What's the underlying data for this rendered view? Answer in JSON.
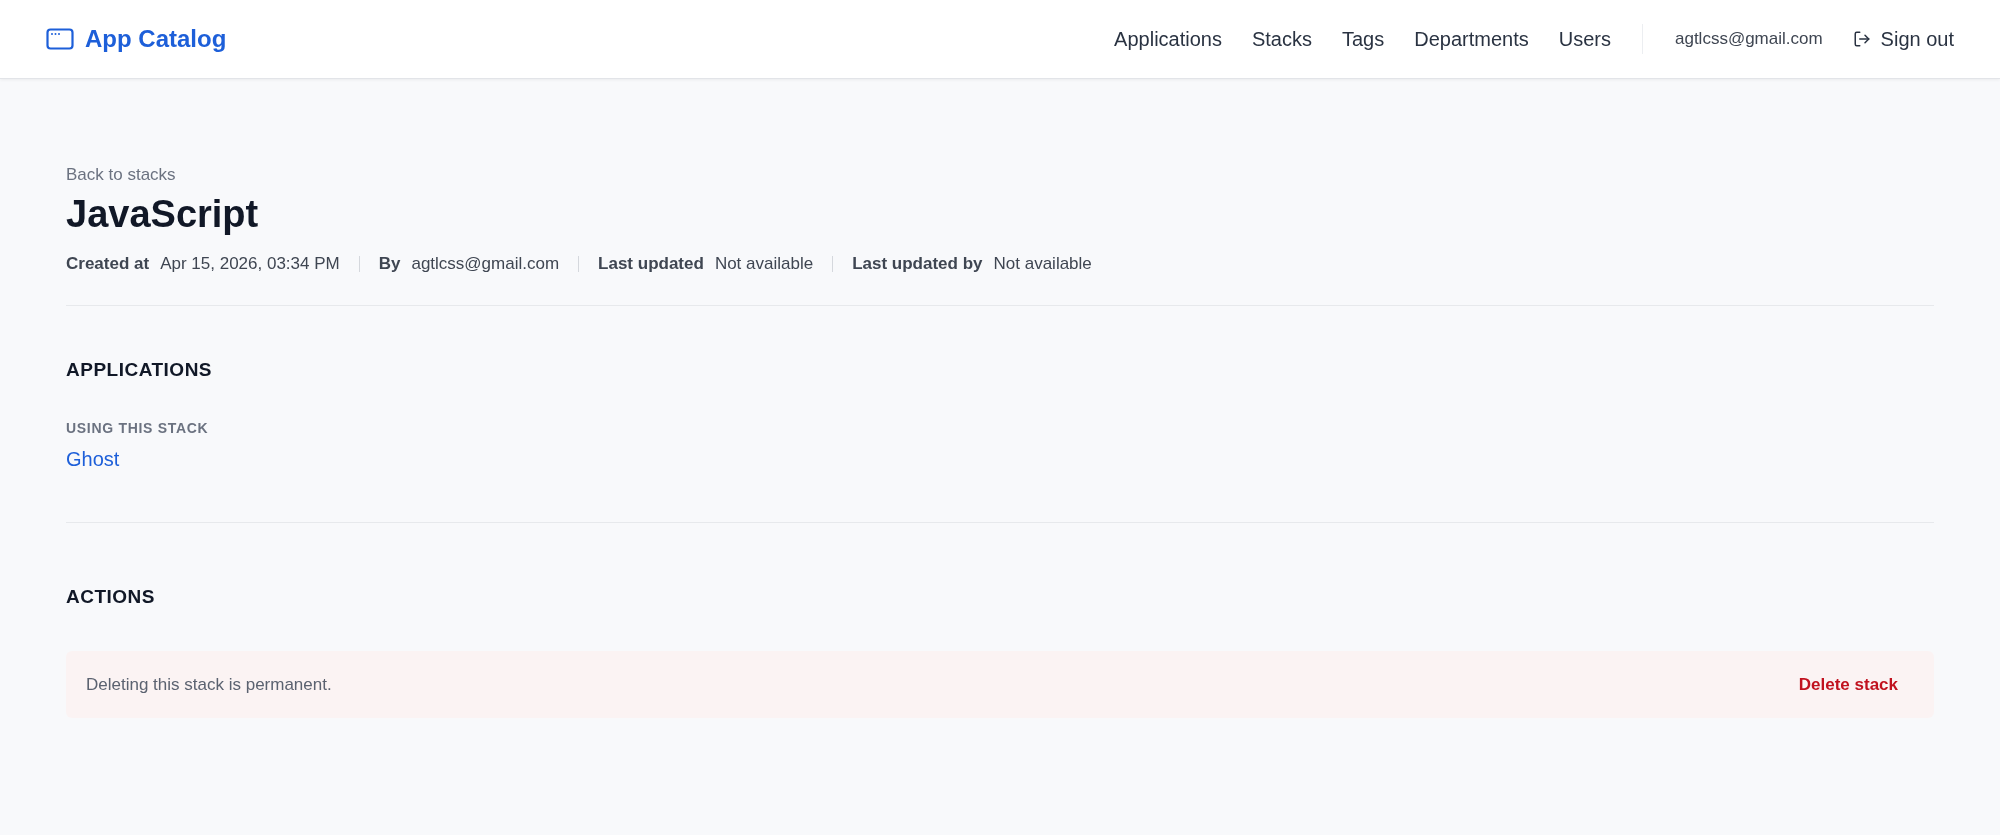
{
  "header": {
    "logo": "App Catalog",
    "nav": [
      {
        "label": "Applications",
        "selected": false
      },
      {
        "label": "Stacks",
        "selected": false
      },
      {
        "label": "Tags",
        "selected": false
      },
      {
        "label": "Departments",
        "selected": false
      },
      {
        "label": "Users",
        "selected": false
      }
    ],
    "user_email": "agtlcss@gmail.com",
    "sign_out": "Sign out"
  },
  "back_link": "Back to stacks",
  "title": "JavaScript",
  "meta": [
    {
      "label": "Created at",
      "value": "Apr 15, 2026, 03:34 PM"
    },
    {
      "label": "By",
      "value": "agtlcss@gmail.com"
    },
    {
      "label": "Last updated",
      "value": "Not available"
    },
    {
      "label": "Last updated by",
      "value": "Not available"
    }
  ],
  "applications": {
    "heading": "APPLICATIONS",
    "subheading": "USING THIS STACK",
    "items": [
      "Ghost"
    ]
  },
  "actions": {
    "heading": "ACTIONS",
    "message": "Deleting this stack is permanent.",
    "button": "Delete stack"
  }
}
